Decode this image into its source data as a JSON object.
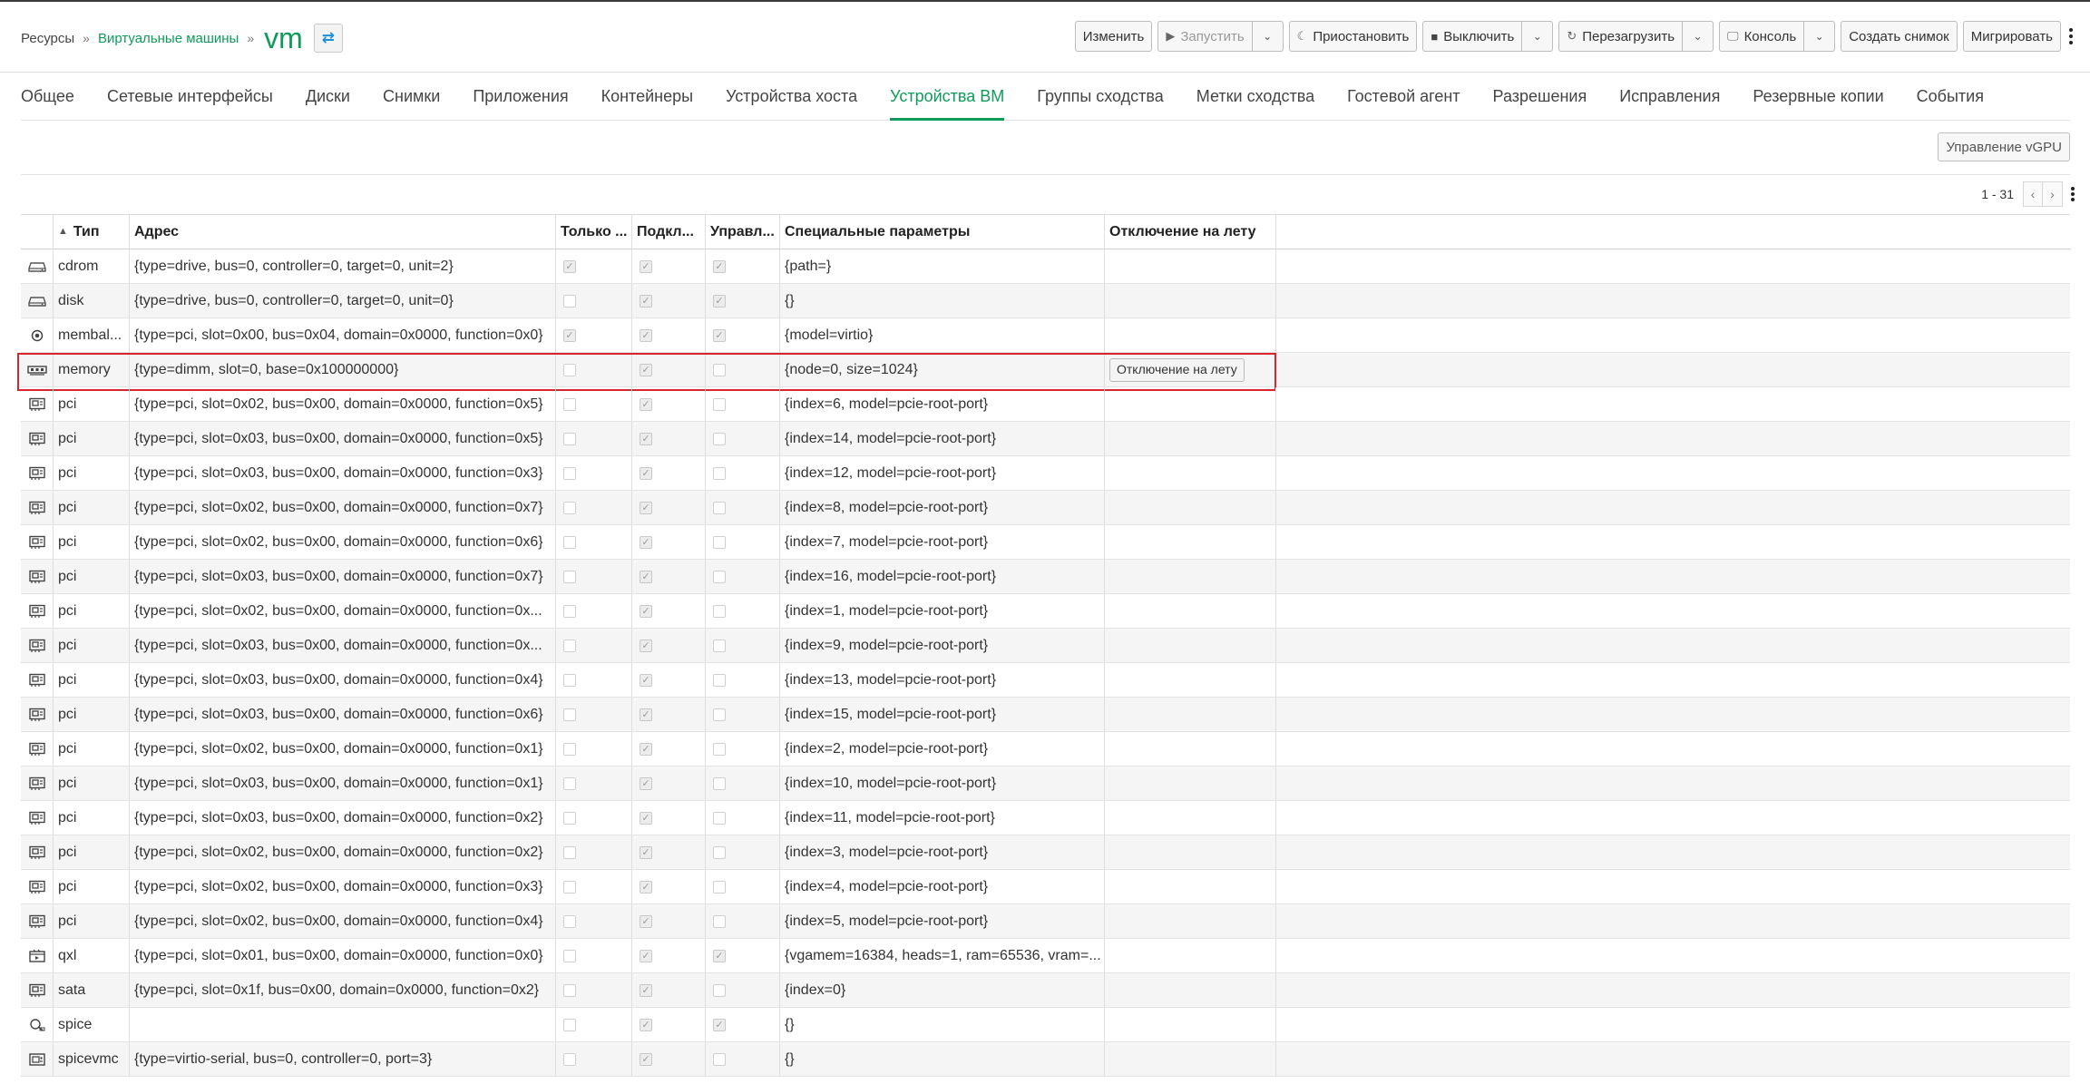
{
  "breadcrumb": {
    "root": "Ресурсы",
    "section": "Виртуальные машины",
    "title": "vm"
  },
  "toolbar": {
    "edit": "Изменить",
    "start": "Запустить",
    "pause": "Приостановить",
    "shutdown": "Выключить",
    "reboot": "Перезагрузить",
    "console": "Консоль",
    "snapshot": "Создать снимок",
    "migrate": "Мигрировать"
  },
  "tabs": [
    "Общее",
    "Сетевые интерфейсы",
    "Диски",
    "Снимки",
    "Приложения",
    "Контейнеры",
    "Устройства хоста",
    "Устройства ВМ",
    "Группы сходства",
    "Метки сходства",
    "Гостевой агент",
    "Разрешения",
    "Исправления",
    "Резервные копии",
    "События"
  ],
  "active_tab": "Устройства ВМ",
  "vgpu_button": "Управление vGPU",
  "pager": {
    "range": "1 - 31"
  },
  "columns": {
    "type": "Тип",
    "address": "Адрес",
    "readonly": "Только ...",
    "plugged": "Подкл...",
    "managed": "Управл...",
    "special": "Специальные параметры",
    "hotunplug": "Отключение на лету"
  },
  "hotunplug_button": "Отключение на лету",
  "rows": [
    {
      "icon": "drive",
      "type": "cdrom",
      "address": "{type=drive, bus=0, controller=0, target=0, unit=2}",
      "readonly": true,
      "plugged": true,
      "managed": true,
      "special": "{path=}",
      "hotunplug": false
    },
    {
      "icon": "drive",
      "type": "disk",
      "address": "{type=drive, bus=0, controller=0, target=0, unit=0}",
      "readonly": false,
      "plugged": true,
      "managed": true,
      "special": "{}",
      "hotunplug": false
    },
    {
      "icon": "balloon",
      "type": "membal...",
      "address": "{type=pci, slot=0x00, bus=0x04, domain=0x0000, function=0x0}",
      "readonly": true,
      "plugged": true,
      "managed": true,
      "special": "{model=virtio}",
      "hotunplug": false
    },
    {
      "icon": "memory",
      "type": "memory",
      "address": "{type=dimm, slot=0, base=0x100000000}",
      "readonly": false,
      "plugged": true,
      "managed": false,
      "special": "{node=0, size=1024}",
      "hotunplug": true
    },
    {
      "icon": "pci",
      "type": "pci",
      "address": "{type=pci, slot=0x02, bus=0x00, domain=0x0000, function=0x5}",
      "readonly": false,
      "plugged": true,
      "managed": false,
      "special": "{index=6, model=pcie-root-port}",
      "hotunplug": false
    },
    {
      "icon": "pci",
      "type": "pci",
      "address": "{type=pci, slot=0x03, bus=0x00, domain=0x0000, function=0x5}",
      "readonly": false,
      "plugged": true,
      "managed": false,
      "special": "{index=14, model=pcie-root-port}",
      "hotunplug": false
    },
    {
      "icon": "pci",
      "type": "pci",
      "address": "{type=pci, slot=0x03, bus=0x00, domain=0x0000, function=0x3}",
      "readonly": false,
      "plugged": true,
      "managed": false,
      "special": "{index=12, model=pcie-root-port}",
      "hotunplug": false
    },
    {
      "icon": "pci",
      "type": "pci",
      "address": "{type=pci, slot=0x02, bus=0x00, domain=0x0000, function=0x7}",
      "readonly": false,
      "plugged": true,
      "managed": false,
      "special": "{index=8, model=pcie-root-port}",
      "hotunplug": false
    },
    {
      "icon": "pci",
      "type": "pci",
      "address": "{type=pci, slot=0x02, bus=0x00, domain=0x0000, function=0x6}",
      "readonly": false,
      "plugged": true,
      "managed": false,
      "special": "{index=7, model=pcie-root-port}",
      "hotunplug": false
    },
    {
      "icon": "pci",
      "type": "pci",
      "address": "{type=pci, slot=0x03, bus=0x00, domain=0x0000, function=0x7}",
      "readonly": false,
      "plugged": true,
      "managed": false,
      "special": "{index=16, model=pcie-root-port}",
      "hotunplug": false
    },
    {
      "icon": "pci",
      "type": "pci",
      "address": "{type=pci, slot=0x02, bus=0x00, domain=0x0000, function=0x...",
      "readonly": false,
      "plugged": true,
      "managed": false,
      "special": "{index=1, model=pcie-root-port}",
      "hotunplug": false
    },
    {
      "icon": "pci",
      "type": "pci",
      "address": "{type=pci, slot=0x03, bus=0x00, domain=0x0000, function=0x...",
      "readonly": false,
      "plugged": true,
      "managed": false,
      "special": "{index=9, model=pcie-root-port}",
      "hotunplug": false
    },
    {
      "icon": "pci",
      "type": "pci",
      "address": "{type=pci, slot=0x03, bus=0x00, domain=0x0000, function=0x4}",
      "readonly": false,
      "plugged": true,
      "managed": false,
      "special": "{index=13, model=pcie-root-port}",
      "hotunplug": false
    },
    {
      "icon": "pci",
      "type": "pci",
      "address": "{type=pci, slot=0x03, bus=0x00, domain=0x0000, function=0x6}",
      "readonly": false,
      "plugged": true,
      "managed": false,
      "special": "{index=15, model=pcie-root-port}",
      "hotunplug": false
    },
    {
      "icon": "pci",
      "type": "pci",
      "address": "{type=pci, slot=0x02, bus=0x00, domain=0x0000, function=0x1}",
      "readonly": false,
      "plugged": true,
      "managed": false,
      "special": "{index=2, model=pcie-root-port}",
      "hotunplug": false
    },
    {
      "icon": "pci",
      "type": "pci",
      "address": "{type=pci, slot=0x03, bus=0x00, domain=0x0000, function=0x1}",
      "readonly": false,
      "plugged": true,
      "managed": false,
      "special": "{index=10, model=pcie-root-port}",
      "hotunplug": false
    },
    {
      "icon": "pci",
      "type": "pci",
      "address": "{type=pci, slot=0x03, bus=0x00, domain=0x0000, function=0x2}",
      "readonly": false,
      "plugged": true,
      "managed": false,
      "special": "{index=11, model=pcie-root-port}",
      "hotunplug": false
    },
    {
      "icon": "pci",
      "type": "pci",
      "address": "{type=pci, slot=0x02, bus=0x00, domain=0x0000, function=0x2}",
      "readonly": false,
      "plugged": true,
      "managed": false,
      "special": "{index=3, model=pcie-root-port}",
      "hotunplug": false
    },
    {
      "icon": "pci",
      "type": "pci",
      "address": "{type=pci, slot=0x02, bus=0x00, domain=0x0000, function=0x3}",
      "readonly": false,
      "plugged": true,
      "managed": false,
      "special": "{index=4, model=pcie-root-port}",
      "hotunplug": false
    },
    {
      "icon": "pci",
      "type": "pci",
      "address": "{type=pci, slot=0x02, bus=0x00, domain=0x0000, function=0x4}",
      "readonly": false,
      "plugged": true,
      "managed": false,
      "special": "{index=5, model=pcie-root-port}",
      "hotunplug": false
    },
    {
      "icon": "video",
      "type": "qxl",
      "address": "{type=pci, slot=0x01, bus=0x00, domain=0x0000, function=0x0}",
      "readonly": false,
      "plugged": true,
      "managed": true,
      "special": "{vgamem=16384, heads=1, ram=65536, vram=...",
      "hotunplug": false
    },
    {
      "icon": "pci",
      "type": "sata",
      "address": "{type=pci, slot=0x1f, bus=0x00, domain=0x0000, function=0x2}",
      "readonly": false,
      "plugged": true,
      "managed": false,
      "special": "{index=0}",
      "hotunplug": false
    },
    {
      "icon": "spice",
      "type": "spice",
      "address": "",
      "readonly": false,
      "plugged": true,
      "managed": true,
      "special": "{}",
      "hotunplug": false
    },
    {
      "icon": "spicevmc",
      "type": "spicevmc",
      "address": "{type=virtio-serial, bus=0, controller=0, port=3}",
      "readonly": false,
      "plugged": true,
      "managed": false,
      "special": "{}",
      "hotunplug": false
    }
  ],
  "highlighted_row": "memory",
  "colors": {
    "accent": "#0f9b5a",
    "highlight": "#d9262c",
    "link_blue": "#1b8fd6"
  }
}
